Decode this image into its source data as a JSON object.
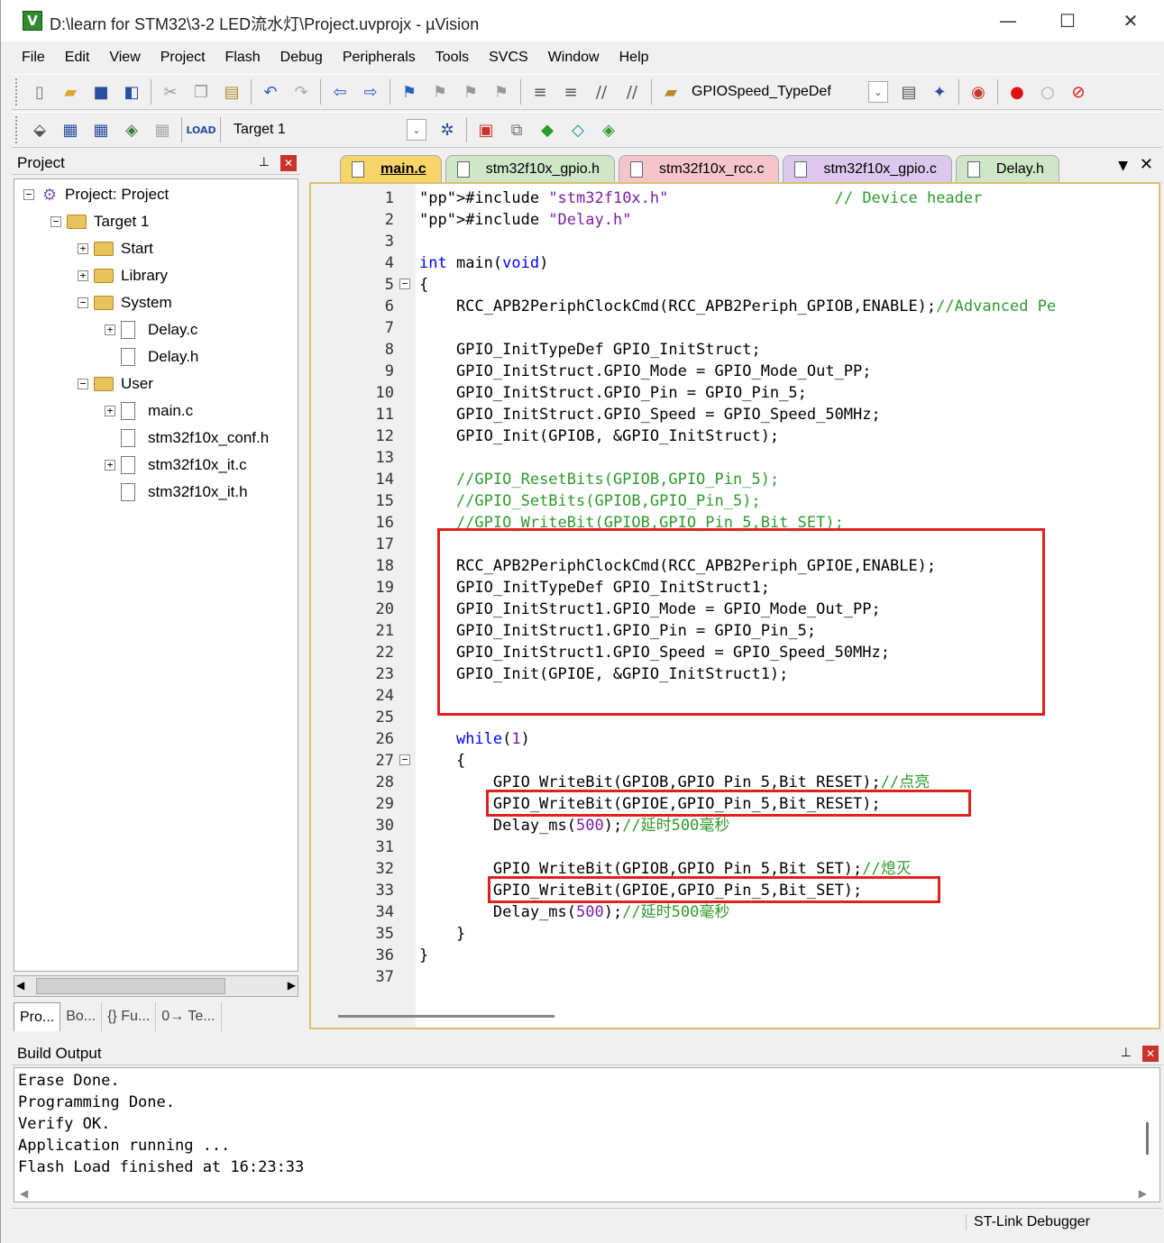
{
  "window": {
    "title": "D:\\learn for STM32\\3-2 LED流水灯\\Project.uvprojx - µVision",
    "minimize": "—",
    "maximize": "☐",
    "close": "✕"
  },
  "menu": [
    "File",
    "Edit",
    "View",
    "Project",
    "Flash",
    "Debug",
    "Peripherals",
    "Tools",
    "SVCS",
    "Window",
    "Help"
  ],
  "toolbar1": {
    "find_value": "GPIOSpeed_TypeDef"
  },
  "toolbar2": {
    "target": "Target 1"
  },
  "project_panel": {
    "title": "Project",
    "pin": "⊥",
    "close": "✕",
    "tree": [
      {
        "label": "Project: Project",
        "exp": "−"
      },
      {
        "label": "Target 1",
        "exp": "−"
      },
      {
        "label": "Start",
        "exp": "+"
      },
      {
        "label": "Library",
        "exp": "+"
      },
      {
        "label": "System",
        "exp": "−"
      },
      {
        "label": "Delay.c",
        "exp": "+"
      },
      {
        "label": "Delay.h",
        "exp": ""
      },
      {
        "label": "User",
        "exp": "−"
      },
      {
        "label": "main.c",
        "exp": "+"
      },
      {
        "label": "stm32f10x_conf.h",
        "exp": ""
      },
      {
        "label": "stm32f10x_it.c",
        "exp": "+"
      },
      {
        "label": "stm32f10x_it.h",
        "exp": ""
      }
    ],
    "bottom_tabs": [
      "Pro...",
      "Bo...",
      "{} Fu...",
      "0→ Te..."
    ]
  },
  "editor": {
    "tabs": [
      {
        "label": "main.c",
        "color": "#f7d568"
      },
      {
        "label": "stm32f10x_gpio.h",
        "color": "#cfe6c8"
      },
      {
        "label": "stm32f10x_rcc.c",
        "color": "#f4c6cc"
      },
      {
        "label": "stm32f10x_gpio.c",
        "color": "#dcc8ec"
      },
      {
        "label": "Delay.h",
        "color": "#cfe6c8"
      }
    ],
    "line_numbers": [
      "1",
      "2",
      "3",
      "4",
      "5",
      "6",
      "7",
      "8",
      "9",
      "10",
      "11",
      "12",
      "13",
      "14",
      "15",
      "16",
      "17",
      "18",
      "19",
      "20",
      "21",
      "22",
      "23",
      "24",
      "25",
      "26",
      "27",
      "28",
      "29",
      "30",
      "31",
      "32",
      "33",
      "34",
      "35",
      "36",
      "37"
    ],
    "lines": [
      "#include \"stm32f10x.h\"                  // Device header",
      "#include \"Delay.h\"",
      "",
      "int main(void)",
      "{",
      "    RCC_APB2PeriphClockCmd(RCC_APB2Periph_GPIOB,ENABLE);//Advanced Pe",
      "",
      "    GPIO_InitTypeDef GPIO_InitStruct;",
      "    GPIO_InitStruct.GPIO_Mode = GPIO_Mode_Out_PP;",
      "    GPIO_InitStruct.GPIO_Pin = GPIO_Pin_5;",
      "    GPIO_InitStruct.GPIO_Speed = GPIO_Speed_50MHz;",
      "    GPIO_Init(GPIOB, &GPIO_InitStruct);",
      "",
      "    //GPIO_ResetBits(GPIOB,GPIO_Pin_5);",
      "    //GPIO_SetBits(GPIOB,GPIO_Pin_5);",
      "    //GPIO_WriteBit(GPIOB,GPIO_Pin_5,Bit_SET);",
      "",
      "    RCC_APB2PeriphClockCmd(RCC_APB2Periph_GPIOE,ENABLE);",
      "    GPIO_InitTypeDef GPIO_InitStruct1;",
      "    GPIO_InitStruct1.GPIO_Mode = GPIO_Mode_Out_PP;",
      "    GPIO_InitStruct1.GPIO_Pin = GPIO_Pin_5;",
      "    GPIO_InitStruct1.GPIO_Speed = GPIO_Speed_50MHz;",
      "    GPIO_Init(GPIOE, &GPIO_InitStruct1);",
      "",
      "",
      "    while(1)",
      "    {",
      "        GPIO_WriteBit(GPIOB,GPIO_Pin_5,Bit_RESET);//点亮",
      "        GPIO_WriteBit(GPIOE,GPIO_Pin_5,Bit_RESET);",
      "        Delay_ms(500);//延时500毫秒",
      "",
      "        GPIO_WriteBit(GPIOB,GPIO_Pin_5,Bit_SET);//熄灭",
      "        GPIO_WriteBit(GPIOE,GPIO_Pin_5,Bit_SET);",
      "        Delay_ms(500);//延时500毫秒",
      "    }",
      "}",
      ""
    ]
  },
  "build_output": {
    "title": "Build Output",
    "pin": "⊥",
    "close": "✕",
    "lines": [
      "Erase Done.",
      "Programming Done.",
      "Verify OK.",
      "Application running ...",
      "Flash Load finished at 16:23:33"
    ]
  },
  "status_bar": {
    "debugger": "ST-Link Debugger"
  }
}
